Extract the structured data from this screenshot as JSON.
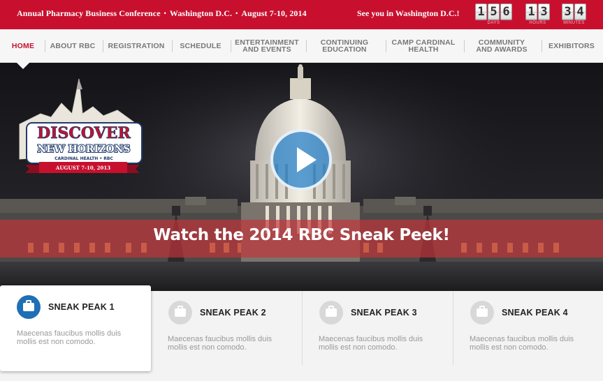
{
  "topbar": {
    "conference": "Annual Pharmacy Business Conference",
    "location": "Washington D.C.",
    "dates": "August 7-10, 2014",
    "separator": "•",
    "see_you": "See you in Washington D.C.!"
  },
  "countdown": {
    "days": [
      "1",
      "5",
      "6"
    ],
    "hours": [
      "1",
      "3"
    ],
    "minutes": [
      "3",
      "4"
    ],
    "days_label": "DAYS",
    "hours_label": "HOURS",
    "minutes_label": "MINUTES"
  },
  "nav": {
    "items": [
      {
        "line1": "HOME",
        "line2": ""
      },
      {
        "line1": "ABOUT RBC",
        "line2": ""
      },
      {
        "line1": "REGISTRATION",
        "line2": ""
      },
      {
        "line1": "SCHEDULE",
        "line2": ""
      },
      {
        "line1": "ENTERTAINMENT",
        "line2": "AND EVENTS"
      },
      {
        "line1": "CONTINUING",
        "line2": "EDUCATION"
      },
      {
        "line1": "CAMP CARDINAL",
        "line2": "HEALTH"
      },
      {
        "line1": "COMMUNITY",
        "line2": "AND AWARDS"
      },
      {
        "line1": "EXHIBITORS",
        "line2": ""
      }
    ]
  },
  "hero": {
    "caption": "Watch the 2014 RBC Sneak Peek!",
    "logo": {
      "line1": "DISCOVER",
      "line2": "NEW HORIZONS",
      "line3": "CARDINAL HEALTH • RBC",
      "ribbon": "AUGUST 7-10, 2013"
    }
  },
  "cards": [
    {
      "title": "SNEAK PEAK 1",
      "text": "Maecenas faucibus mollis duis mollis est non comodo."
    },
    {
      "title": "SNEAK PEAK 2",
      "text": "Maecenas faucibus mollis duis mollis est non comodo."
    },
    {
      "title": "SNEAK PEAK 3",
      "text": "Maecenas faucibus mollis duis mollis est non comodo."
    },
    {
      "title": "SNEAK PEAK 4",
      "text": "Maecenas faucibus mollis duis mollis est non comodo."
    }
  ],
  "colors": {
    "brand_red": "#c8102e",
    "active_blue": "#1e6fb5"
  }
}
